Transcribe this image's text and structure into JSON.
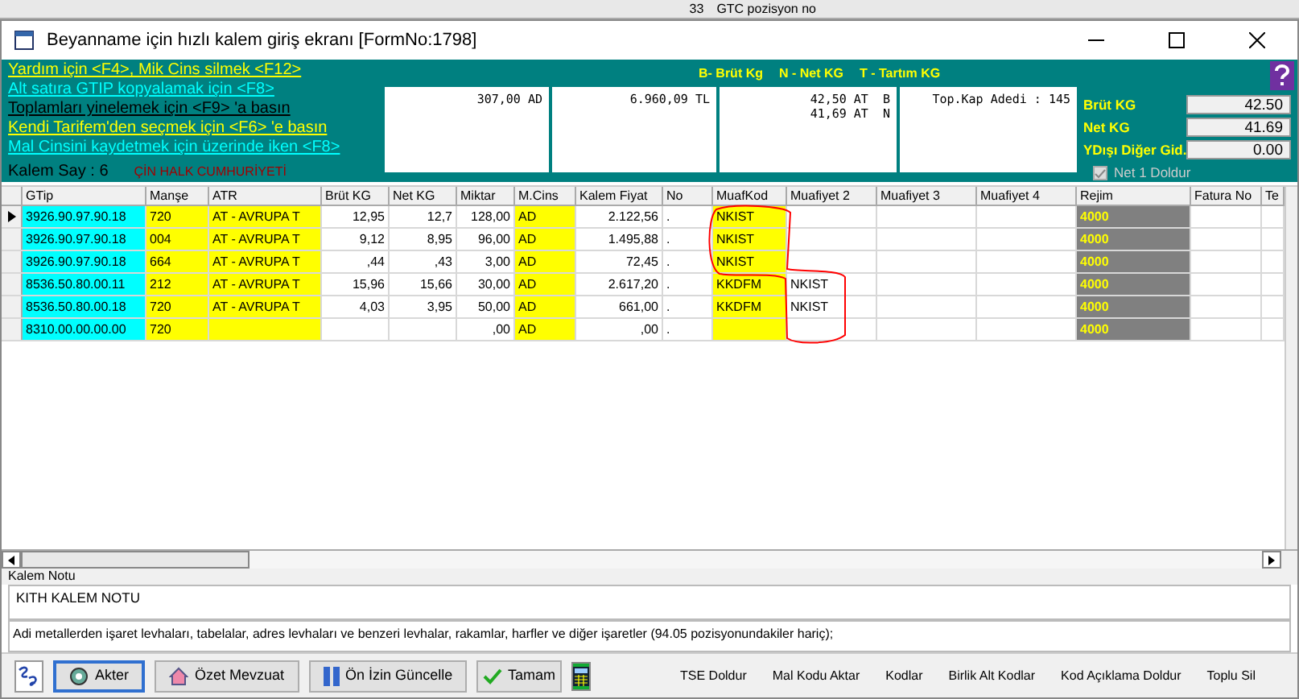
{
  "background_strip": {
    "items": [
      "33",
      "GTC pozisyon no"
    ]
  },
  "window": {
    "title": "Beyanname için hızlı kalem giriş ekranı [FormNo:1798]"
  },
  "help_lines": [
    {
      "text": "Yardım için <F4>, Mik Cins silmek <F12>",
      "color": "#ffff00"
    },
    {
      "text": "Alt satıra GTIP kopyalamak için <F8>",
      "color": "#00ffff"
    },
    {
      "text": "Toplamları yinelemek için <F9> 'a basın",
      "color": "#000000"
    },
    {
      "text": "Kendi Tarifem'den seçmek  için <F6> 'e basın",
      "color": "#ffff00"
    },
    {
      "text": "Mal Cinsini kaydetmek için üzerinde iken <F8>",
      "color": "#00ffff"
    }
  ],
  "kalem_say": "Kalem Say : 6",
  "country": "ÇİN HALK CUMHURİYETİ",
  "legend": [
    "B- Brüt Kg",
    "N - Net KG",
    "T - Tartım KG"
  ],
  "summary_boxes": [
    {
      "lines": [
        "307,00 AD"
      ]
    },
    {
      "lines": [
        "6.960,09 TL"
      ]
    },
    {
      "lines": [
        "42,50 AT  B",
        "41,69 AT  N"
      ]
    },
    {
      "lines": [
        "Top.Kap Adedi : 145"
      ]
    }
  ],
  "totals": [
    {
      "label": "Brüt KG",
      "value": "42.50"
    },
    {
      "label": "Net KG",
      "value": "41.69"
    },
    {
      "label": "YDışı Diğer Gid.",
      "value": "0.00"
    }
  ],
  "net_checkbox": {
    "label": "Net 1 Doldur",
    "checked": true
  },
  "table": {
    "columns": [
      "GTip",
      "Manşe",
      "ATR",
      "Brüt KG",
      "Net KG",
      "Miktar",
      "M.Cins",
      "Kalem Fiyat",
      "No",
      "MuafKod",
      "Muafiyet 2",
      "Muafiyet 3",
      "Muafiyet 4",
      "Rejim",
      "Fatura No",
      "Te"
    ],
    "rows": [
      {
        "current": true,
        "cells": [
          "3926.90.97.90.18",
          "720",
          "AT - AVRUPA T",
          "12,95",
          "12,7",
          "128,00",
          "AD",
          "2.122,56",
          ".",
          "NKIST",
          null,
          null,
          null,
          "4000",
          null,
          null
        ]
      },
      {
        "current": false,
        "cells": [
          "3926.90.97.90.18",
          "004",
          "AT - AVRUPA T",
          "9,12",
          "8,95",
          "96,00",
          "AD",
          "1.495,88",
          ".",
          "NKIST",
          null,
          null,
          null,
          "4000",
          null,
          null
        ]
      },
      {
        "current": false,
        "cells": [
          "3926.90.97.90.18",
          "664",
          "AT - AVRUPA T",
          ",44",
          ",43",
          "3,00",
          "AD",
          "72,45",
          ".",
          "NKIST",
          null,
          null,
          null,
          "4000",
          null,
          null
        ]
      },
      {
        "current": false,
        "cells": [
          "8536.50.80.00.11",
          "212",
          "AT - AVRUPA T",
          "15,96",
          "15,66",
          "30,00",
          "AD",
          "2.617,20",
          ".",
          "KKDFM",
          "NKIST",
          null,
          null,
          "4000",
          null,
          null
        ]
      },
      {
        "current": false,
        "cells": [
          "8536.50.80.00.18",
          "720",
          "AT - AVRUPA T",
          "4,03",
          "3,95",
          "50,00",
          "AD",
          "661,00",
          ".",
          "KKDFM",
          "NKIST",
          null,
          null,
          "4000",
          null,
          null
        ]
      },
      {
        "current": false,
        "cells": [
          "8310.00.00.00.00",
          "720",
          null,
          null,
          null,
          ",00",
          "AD",
          ",00",
          ".",
          null,
          null,
          null,
          null,
          "4000",
          null,
          null
        ]
      }
    ]
  },
  "kalem_notu": {
    "label": "Kalem Notu",
    "value": "KITH KALEM NOTU"
  },
  "description": "Adi metallerden işaret levhaları, tabelalar, adres levhaları ve benzeri levhalar, rakamlar, harfler ve diğer işaretler (94.05 pozisyonundakiler hariç);",
  "buttons": [
    {
      "label": "Akter",
      "kind": "raised",
      "selected": true
    },
    {
      "label": "Özet Mevzuat",
      "kind": "raised",
      "selected": false
    },
    {
      "label": "Ön İzin Güncelle",
      "kind": "raised",
      "selected": false
    },
    {
      "label": "Tamam",
      "kind": "wide",
      "selected": false
    }
  ],
  "flat_buttons": [
    "TSE Doldur",
    "Mal Kodu Aktar",
    "Kodlar",
    "Birlik Alt Kodlar",
    "Kod Açıklama Doldur",
    "Toplu Sil"
  ]
}
